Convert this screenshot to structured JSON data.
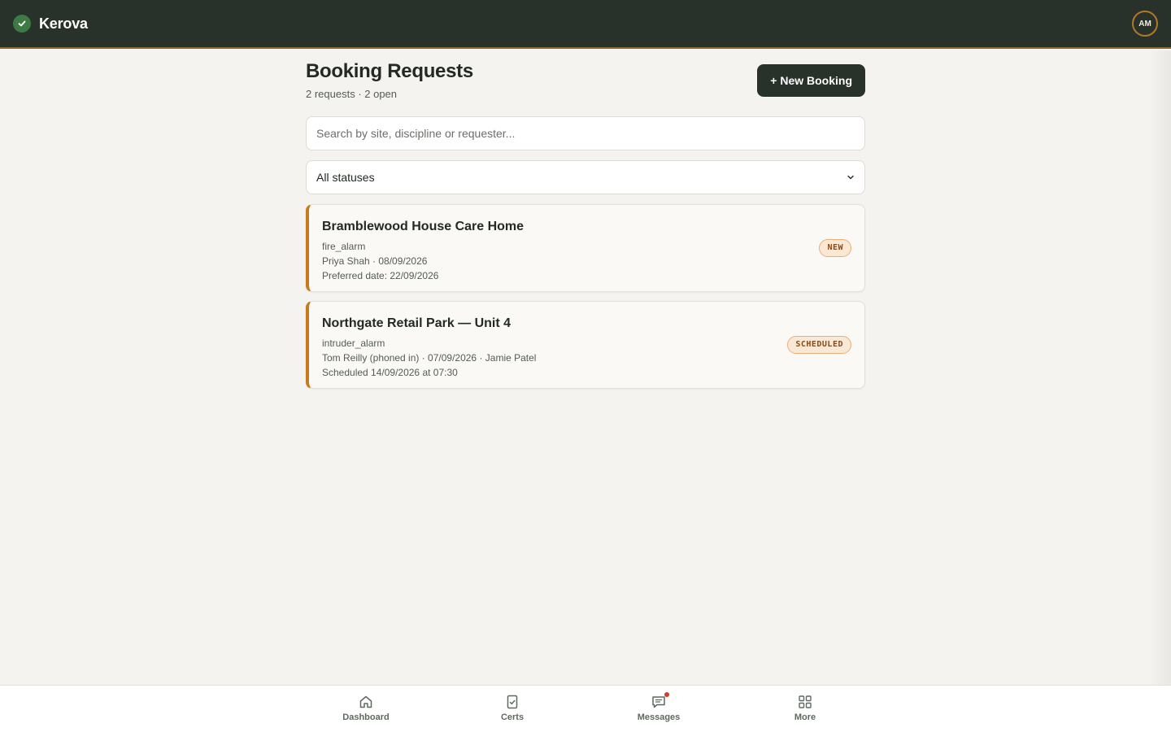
{
  "app": {
    "name": "Kerova",
    "user_initials": "AM"
  },
  "page": {
    "title": "Booking Requests",
    "subtitle": "2 requests · 2 open",
    "new_button_label": "+ New Booking"
  },
  "search": {
    "placeholder": "Search by site, discipline or requester...",
    "value": ""
  },
  "status_filter": {
    "selected": "All statuses"
  },
  "bookings": [
    {
      "site": "Bramblewood House Care Home",
      "discipline": "fire_alarm",
      "requester_line": "Priya Shah · 08/09/2026",
      "date_line": "Preferred date: 22/09/2026",
      "status": "NEW"
    },
    {
      "site": "Northgate Retail Park — Unit 4",
      "discipline": "intruder_alarm",
      "requester_line": "Tom Reilly (phoned in) · 07/09/2026 · Jamie Patel",
      "date_line": "Scheduled 14/09/2026 at 07:30",
      "status": "SCHEDULED"
    }
  ],
  "bottom_nav": [
    {
      "label": "Dashboard",
      "icon": "home-icon"
    },
    {
      "label": "Certs",
      "icon": "certificate-icon"
    },
    {
      "label": "Messages",
      "icon": "chat-icon",
      "has_notification": true
    },
    {
      "label": "More",
      "icon": "grid-icon"
    }
  ],
  "colors": {
    "topbar": "#28312a",
    "accent": "#c9791e",
    "brand_badge": "#3e7a45",
    "notification": "#d63a2a"
  }
}
